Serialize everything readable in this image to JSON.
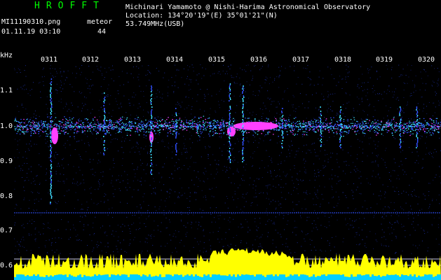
{
  "header": {
    "app_title": "HROFFT",
    "observer": "Michinari Yamamoto @ Nishi-Harima Astronomical Observatory",
    "location": "Location: 134°20'19\"(E) 35°01'21\"(N)",
    "frequency": "53.749MHz(USB)",
    "filename": "MI11190310.png",
    "meteor_label": "meteor",
    "datetime": "01.11.19 03:10",
    "meteor_count": "44"
  },
  "axes": {
    "y_unit": "kHz",
    "x_ticks": [
      "0311",
      "0312",
      "0313",
      "0314",
      "0315",
      "0316",
      "0317",
      "0318",
      "0319",
      "0320"
    ],
    "y_ticks": [
      "1.1",
      "1.0",
      "0.9",
      "0.8",
      "0.7",
      "0.6"
    ]
  },
  "colors": {
    "background": "#000000",
    "title": "#00ff00",
    "text": "#ffffff",
    "noise_floor": "#ffff00",
    "bottom_band": "#00d0ff",
    "hot": "#ff40ff",
    "mid": "#40e0ff",
    "low": "#3050ff"
  }
}
